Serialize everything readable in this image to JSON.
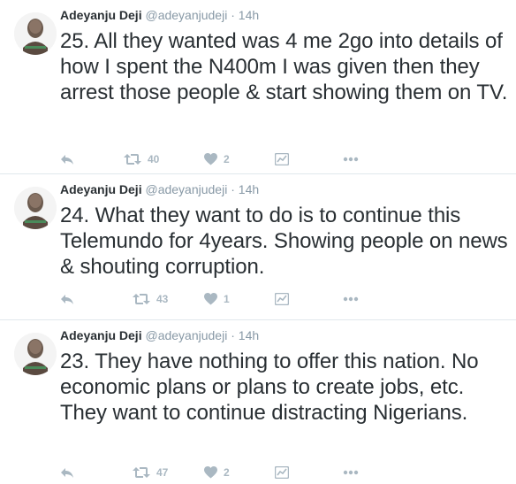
{
  "colors": {
    "text": "#292f33",
    "muted": "#8899a6",
    "icon": "#aab8c2",
    "divider": "#e1e8ed"
  },
  "tweets": [
    {
      "name": "Adeyanju Deji",
      "handle": "@adeyanjudeji",
      "separator": "·",
      "time": "14h",
      "text": "25. All they wanted was 4 me 2go into details of how I spent the N400m I was given then they arrest those people & start showing them on TV.",
      "retweets": "40",
      "likes": "2"
    },
    {
      "name": "Adeyanju Deji",
      "handle": "@adeyanjudeji",
      "separator": "·",
      "time": "14h",
      "text": "24. What they want to do is to continue this Telemundo for 4years. Showing people on news & shouting corruption.",
      "retweets": "43",
      "likes": "1"
    },
    {
      "name": "Adeyanju Deji",
      "handle": "@adeyanjudeji",
      "separator": "·",
      "time": "14h",
      "text": "23. They have nothing to offer this nation. No economic plans or plans to create jobs, etc. They want to continue distracting Nigerians.",
      "retweets": "47",
      "likes": "2"
    }
  ]
}
